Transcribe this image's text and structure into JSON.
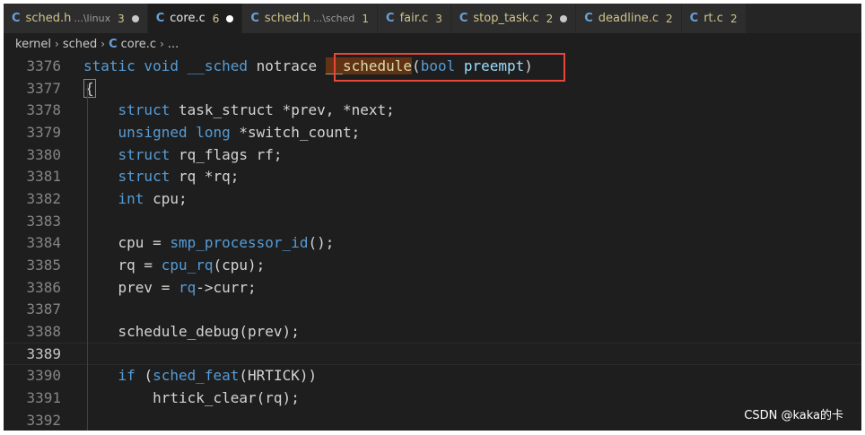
{
  "tabs": [
    {
      "icon": "C",
      "name": "sched.h",
      "dir": "...\\linux",
      "count": "3",
      "modified": true,
      "active": false
    },
    {
      "icon": "C",
      "name": "core.c",
      "dir": "",
      "count": "6",
      "modified": true,
      "active": true
    },
    {
      "icon": "C",
      "name": "sched.h",
      "dir": "...\\sched",
      "count": "1",
      "modified": false,
      "active": false
    },
    {
      "icon": "C",
      "name": "fair.c",
      "dir": "",
      "count": "3",
      "modified": false,
      "active": false
    },
    {
      "icon": "C",
      "name": "stop_task.c",
      "dir": "",
      "count": "2",
      "modified": true,
      "active": false
    },
    {
      "icon": "C",
      "name": "deadline.c",
      "dir": "",
      "count": "2",
      "modified": false,
      "active": false
    },
    {
      "icon": "C",
      "name": "rt.c",
      "dir": "",
      "count": "2",
      "modified": false,
      "active": false
    }
  ],
  "breadcrumb": {
    "items": [
      "kernel",
      "sched",
      "core.c",
      "..."
    ],
    "file_icon": "C"
  },
  "code": {
    "lines": [
      {
        "num": "3376",
        "tokens": [
          {
            "t": "static void ",
            "c": "kw"
          },
          {
            "t": "__sched ",
            "c": "kw"
          },
          {
            "t": "notrace ",
            "c": "pl"
          },
          {
            "t": "__schedule",
            "c": "hl"
          },
          {
            "t": "(",
            "c": "pl"
          },
          {
            "t": "bool ",
            "c": "kw"
          },
          {
            "t": "preempt",
            "c": "var"
          },
          {
            "t": ")",
            "c": "pl"
          }
        ]
      },
      {
        "num": "3377",
        "tokens": [
          {
            "t": "{",
            "c": "brace"
          }
        ]
      },
      {
        "num": "3378",
        "tokens": [
          {
            "t": "    struct ",
            "c": "kw"
          },
          {
            "t": "task_struct ",
            "c": "pl"
          },
          {
            "t": "*prev, *next;",
            "c": "pl"
          }
        ]
      },
      {
        "num": "3379",
        "tokens": [
          {
            "t": "    unsigned long ",
            "c": "kw"
          },
          {
            "t": "*switch_count;",
            "c": "pl"
          }
        ]
      },
      {
        "num": "3380",
        "tokens": [
          {
            "t": "    struct ",
            "c": "kw"
          },
          {
            "t": "rq_flags rf;",
            "c": "pl"
          }
        ]
      },
      {
        "num": "3381",
        "tokens": [
          {
            "t": "    struct ",
            "c": "kw"
          },
          {
            "t": "rq *rq;",
            "c": "pl"
          }
        ]
      },
      {
        "num": "3382",
        "tokens": [
          {
            "t": "    int ",
            "c": "kw"
          },
          {
            "t": "cpu;",
            "c": "pl"
          }
        ]
      },
      {
        "num": "3383",
        "tokens": []
      },
      {
        "num": "3384",
        "tokens": [
          {
            "t": "    cpu = ",
            "c": "pl"
          },
          {
            "t": "smp_processor_id",
            "c": "kw"
          },
          {
            "t": "();",
            "c": "pl"
          }
        ]
      },
      {
        "num": "3385",
        "tokens": [
          {
            "t": "    rq = ",
            "c": "pl"
          },
          {
            "t": "cpu_rq",
            "c": "kw"
          },
          {
            "t": "(cpu);",
            "c": "pl"
          }
        ]
      },
      {
        "num": "3386",
        "tokens": [
          {
            "t": "    prev = ",
            "c": "pl"
          },
          {
            "t": "rq",
            "c": "kw"
          },
          {
            "t": "->curr;",
            "c": "pl"
          }
        ]
      },
      {
        "num": "3387",
        "tokens": []
      },
      {
        "num": "3388",
        "tokens": [
          {
            "t": "    schedule_debug(prev);",
            "c": "pl"
          }
        ]
      },
      {
        "num": "3389",
        "tokens": [],
        "current": true
      },
      {
        "num": "3390",
        "tokens": [
          {
            "t": "    if ",
            "c": "kw"
          },
          {
            "t": "(",
            "c": "pl"
          },
          {
            "t": "sched_feat",
            "c": "kw"
          },
          {
            "t": "(HRTICK))",
            "c": "pl"
          }
        ]
      },
      {
        "num": "3391",
        "tokens": [
          {
            "t": "        hrtick_clear(rq);",
            "c": "pl"
          }
        ]
      },
      {
        "num": "3392",
        "tokens": []
      }
    ]
  },
  "watermark": "CSDN @kaka的卡",
  "colors": {
    "editor_bg": "#1e1e1e",
    "keyword": "#569cd6",
    "line_number": "#858585",
    "annotation_border": "#e8463a",
    "highlight_bg": "#613214"
  }
}
